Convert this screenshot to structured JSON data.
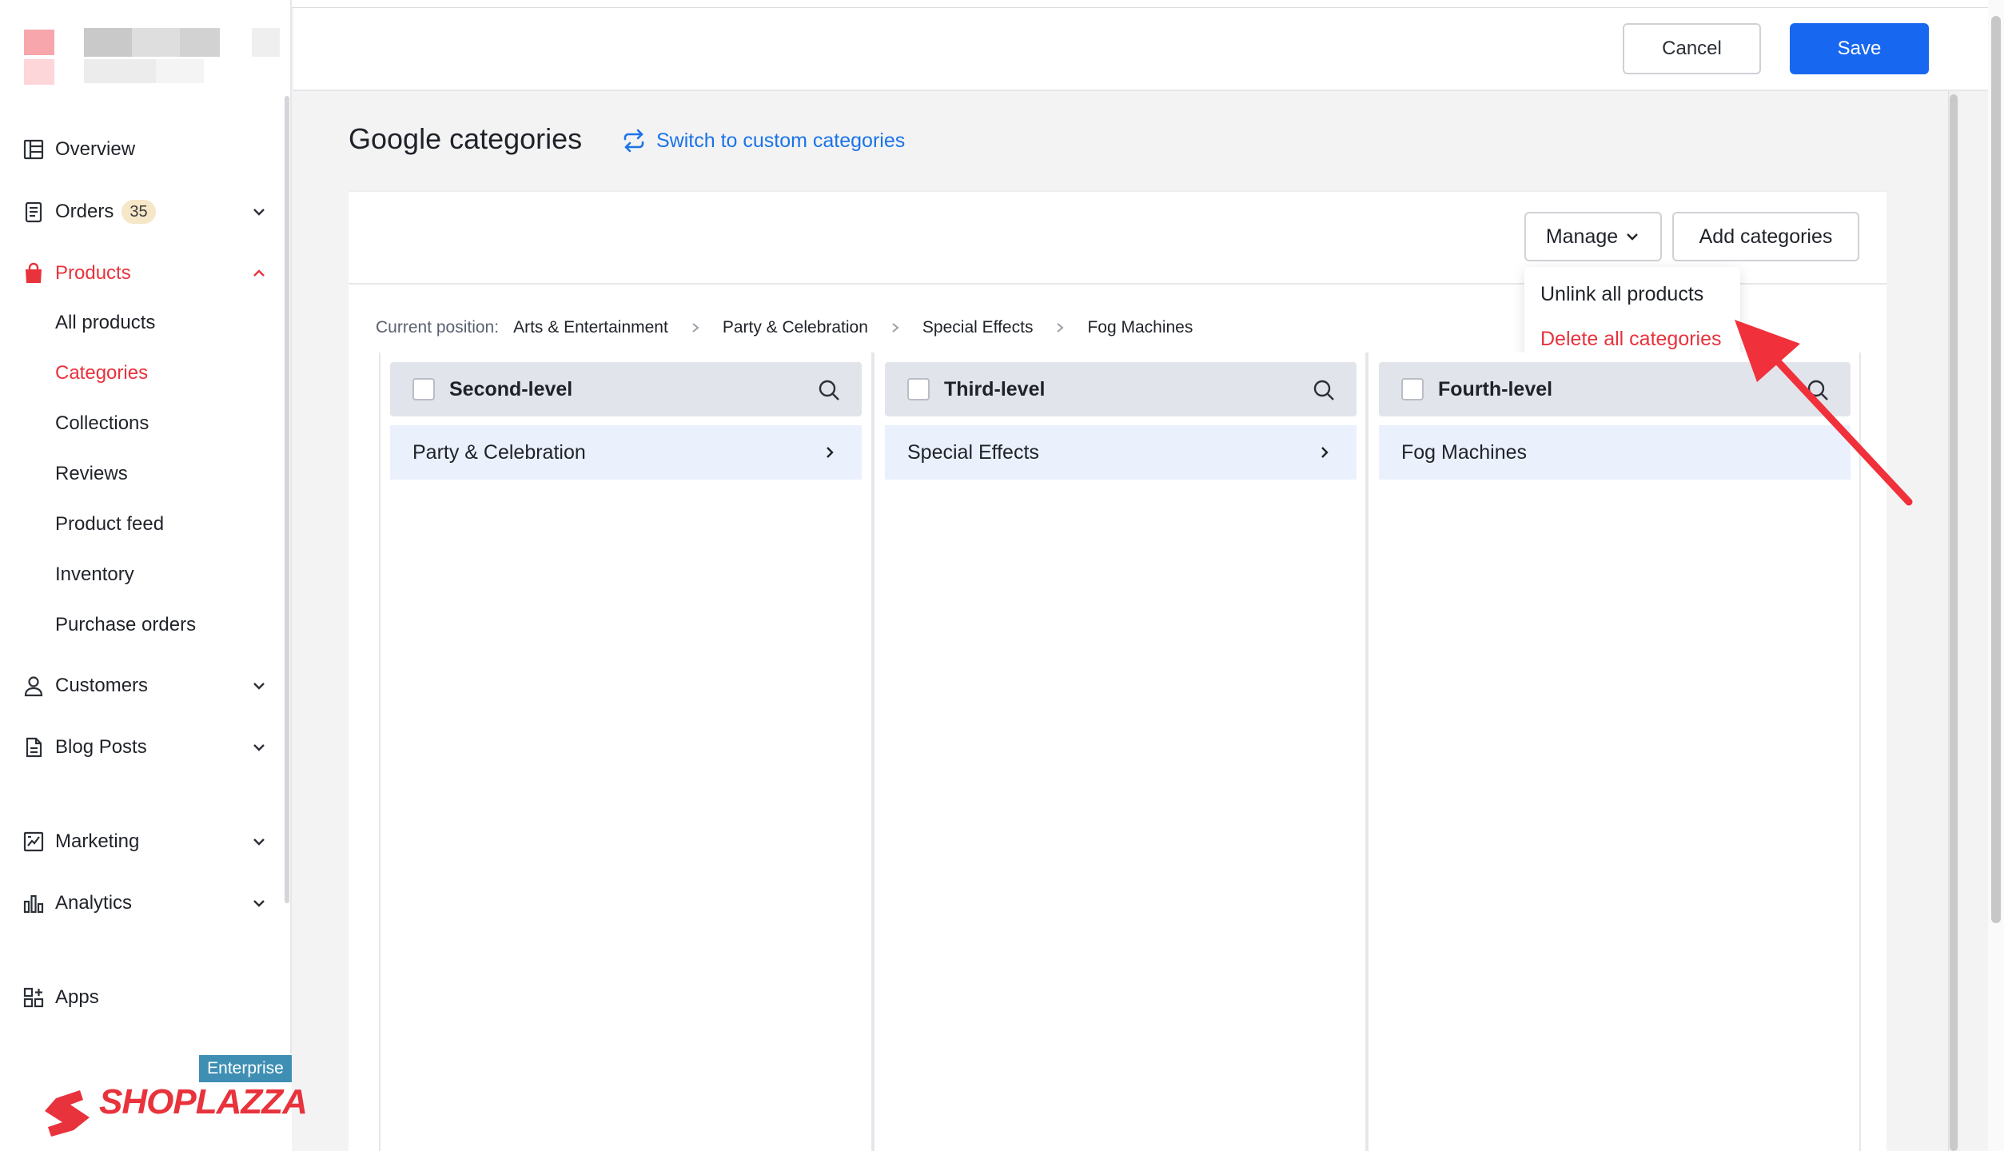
{
  "header": {
    "cancel_label": "Cancel",
    "save_label": "Save"
  },
  "sidebar": {
    "overview": "Overview",
    "orders": {
      "label": "Orders",
      "badge": "35"
    },
    "products": "Products",
    "products_sub": [
      "All products",
      "Categories",
      "Collections",
      "Reviews",
      "Product feed",
      "Inventory",
      "Purchase orders"
    ],
    "customers": "Customers",
    "blog_posts": "Blog Posts",
    "marketing": "Marketing",
    "analytics": "Analytics",
    "apps": "Apps",
    "brand_tag": "Enterprise",
    "brand_name": "SHOPLAZZA"
  },
  "main": {
    "title": "Google categories",
    "switch_link": "Switch to custom categories",
    "manage_label": "Manage",
    "add_label": "Add categories",
    "dropdown": {
      "unlink": "Unlink all products",
      "delete": "Delete all categories"
    },
    "breadcrumb": {
      "label": "Current position:",
      "items": [
        "Arts & Entertainment",
        "Party & Celebration",
        "Special Effects",
        "Fog Machines"
      ]
    },
    "columns": [
      {
        "title": "Second-level",
        "row": "Party & Celebration"
      },
      {
        "title": "Third-level",
        "row": "Special Effects"
      },
      {
        "title": "Fourth-level",
        "row": "Fog Machines"
      }
    ]
  },
  "colors": {
    "accent_red": "#e8323c",
    "primary_blue": "#1867f0",
    "link_blue": "#1a73e8"
  }
}
